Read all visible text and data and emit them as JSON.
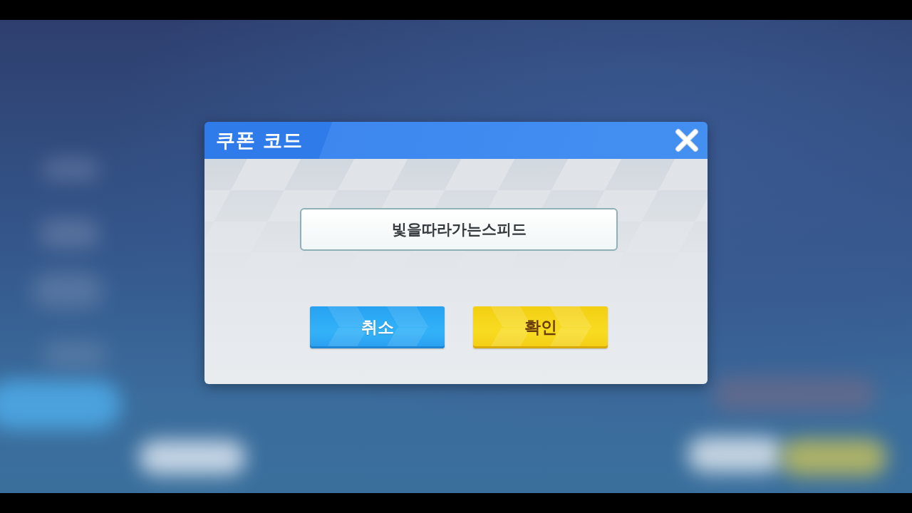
{
  "dialog": {
    "title": "쿠폰 코드",
    "coupon_code_field": {
      "value": "빛을따라가는스피드"
    },
    "buttons": [
      {
        "label": "취소",
        "kind": "cancel"
      },
      {
        "label": "확인",
        "kind": "confirm"
      }
    ]
  }
}
